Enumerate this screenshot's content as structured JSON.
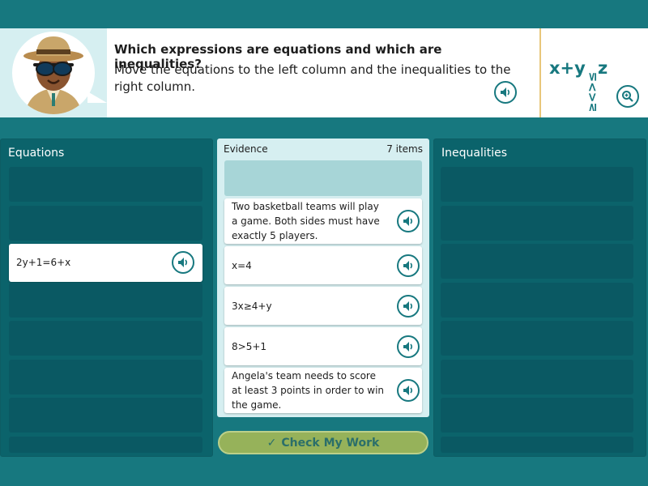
{
  "header": {
    "title": "Which expressions are equations and which are inequalities?",
    "instructions": "Move the equations to the left column and the inequalities to the right column.",
    "math_icon": {
      "expr": "x+y",
      "right": "z",
      "symbols": [
        "≥",
        "<",
        ">",
        "≤"
      ]
    },
    "accent": "#17787f"
  },
  "columns": {
    "equations": {
      "title": "Equations",
      "placed": [
        {
          "slot": 3,
          "text": "2y+1=6+x"
        }
      ]
    },
    "inequalities": {
      "title": "Inequalities",
      "placed": []
    }
  },
  "evidence": {
    "title": "Evidence",
    "count_label": "7 items",
    "cards": [
      {
        "text": "Two basketball teams will play a game. Both sides must have exactly 5 players."
      },
      {
        "text": "x=4"
      },
      {
        "text": "3x≥4+y"
      },
      {
        "text": "8>5+1"
      },
      {
        "text": "Angela's team needs to score at least 3 points in order to win the game."
      }
    ]
  },
  "actions": {
    "check_label": "Check My Work",
    "check_icon": "✓"
  },
  "colors": {
    "background": "#17787f",
    "column_bg": "#0b636b",
    "panel_bg": "#d6eff1",
    "check_button": "#96b25a"
  }
}
